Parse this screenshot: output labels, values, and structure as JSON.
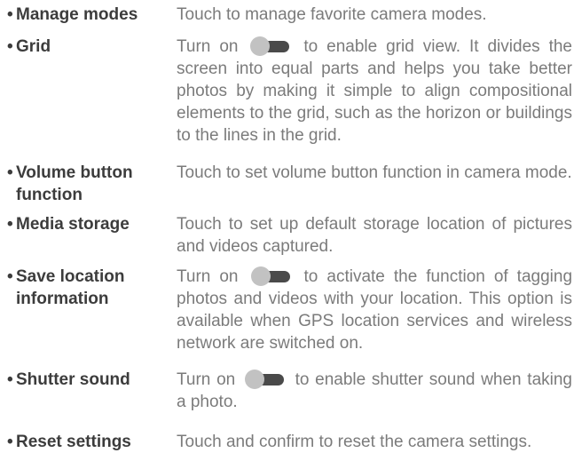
{
  "entries": [
    {
      "term": "Manage modes",
      "desc": "Touch to manage favorite camera modes."
    },
    {
      "term": "Grid",
      "desc_before": "Turn on",
      "desc_after": "to enable grid view. It divides the screen into equal parts and helps you take better photos by making it simple to align compositional elements to the grid, such as the horizon or buildings to the lines in the grid."
    },
    {
      "term_line1": "Volume button",
      "term_line2": "function",
      "desc": "Touch to set volume button function in camera mode."
    },
    {
      "term": "Media storage",
      "desc": "Touch to set up default storage location of pictures and videos captured."
    },
    {
      "term_line1": "Save location",
      "term_line2": "information",
      "desc_before": "Turn on",
      "desc_after": "to activate the function of tagging photos and videos with your location. This option is available when GPS location services and wireless network are switched on."
    },
    {
      "term": "Shutter sound",
      "desc_before": "Turn on",
      "desc_after": "to enable shutter sound when taking a photo."
    },
    {
      "term": "Reset settings",
      "desc": "Touch and confirm to reset the camera settings."
    }
  ],
  "bullet": "•",
  "icons": {
    "toggle": "toggle-switch-icon"
  },
  "colors": {
    "term_text": "#3c3c3c",
    "desc_text": "#7b7b7b",
    "toggle_track": "#4a4a4a",
    "toggle_knob": "#c2c2c2"
  }
}
